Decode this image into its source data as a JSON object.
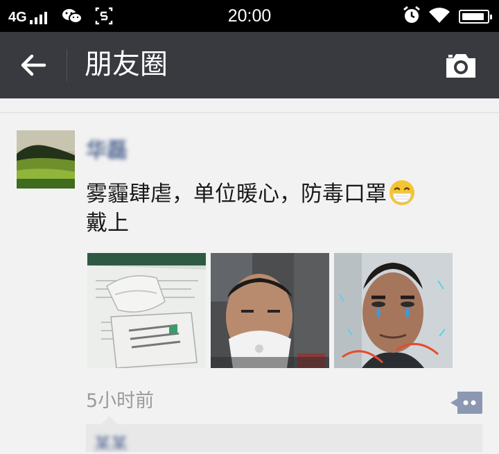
{
  "status_bar": {
    "network": "4G",
    "time": "20:00",
    "icons": [
      "signal-icon",
      "wechat-icon",
      "screenshot-icon",
      "alarm-icon",
      "wifi-icon",
      "battery-icon"
    ],
    "battery_level": 0.9
  },
  "header": {
    "title": "朋友圈",
    "back_icon": "arrow-left-icon",
    "camera_icon": "camera-icon",
    "background": "#393a3f"
  },
  "post": {
    "username": "华磊",
    "text": "雾霾肆虐，单位暖心，防毒口罩",
    "text_line2": "戴上",
    "emoji": "mask-emoji",
    "photos": [
      "masks-on-paper-photo",
      "man-wearing-mask-photo",
      "man-crying-filter-photo"
    ],
    "time": "5小时前",
    "comment_icon": "comment-dots-icon"
  },
  "likes": {
    "names": "某某"
  },
  "colors": {
    "link": "#576b95",
    "time": "#9b9b9b"
  }
}
